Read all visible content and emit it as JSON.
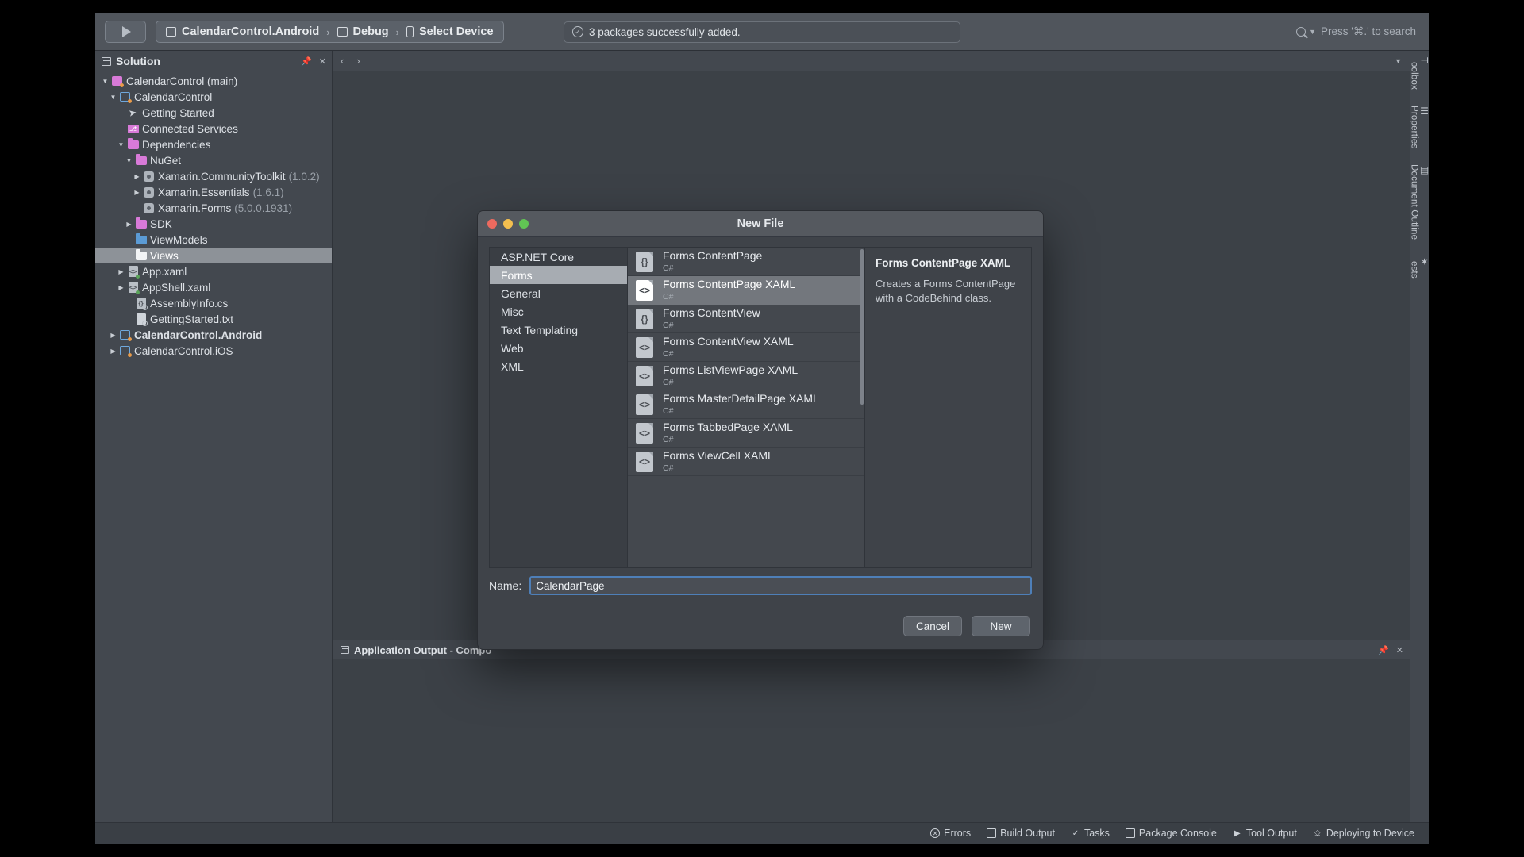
{
  "toolbar": {
    "run_button_icon": "play-triangle-icon",
    "target_project": "CalendarControl.Android",
    "configuration": "Debug",
    "device": "Select Device",
    "separator": "›",
    "status_message": "3 packages successfully added.",
    "status_icon": "check-circle-icon",
    "search_placeholder": "Press '⌘.' to search"
  },
  "solution_pad": {
    "title": "Solution",
    "pin_icon": "pin-icon",
    "close_icon": "close-icon",
    "tree": [
      {
        "label": "CalendarControl (main)",
        "indent": 0,
        "twisty": "▼",
        "icon": "solution-icon",
        "bold": false
      },
      {
        "label": "CalendarControl",
        "indent": 1,
        "twisty": "▼",
        "icon": "project-icon",
        "bold": false
      },
      {
        "label": "Getting Started",
        "indent": 2,
        "twisty": "",
        "icon": "rocket-icon",
        "bold": false
      },
      {
        "label": "Connected Services",
        "indent": 2,
        "twisty": "",
        "icon": "connected-services-icon",
        "bold": false
      },
      {
        "label": "Dependencies",
        "indent": 2,
        "twisty": "▼",
        "icon": "dependencies-folder-icon",
        "bold": false
      },
      {
        "label": "NuGet",
        "indent": 3,
        "twisty": "▼",
        "icon": "nuget-folder-icon",
        "bold": false
      },
      {
        "label": "Xamarin.CommunityToolkit",
        "version": "(1.0.2)",
        "indent": 4,
        "twisty": "▶",
        "icon": "package-icon",
        "bold": false
      },
      {
        "label": "Xamarin.Essentials",
        "version": "(1.6.1)",
        "indent": 4,
        "twisty": "▶",
        "icon": "package-icon",
        "bold": false
      },
      {
        "label": "Xamarin.Forms",
        "version": "(5.0.0.1931)",
        "indent": 4,
        "twisty": "",
        "icon": "package-icon",
        "bold": false
      },
      {
        "label": "SDK",
        "indent": 3,
        "twisty": "▶",
        "icon": "sdk-folder-icon",
        "bold": false
      },
      {
        "label": "ViewModels",
        "indent": 3,
        "twisty": "",
        "icon": "folder-blue-icon",
        "bold": false
      },
      {
        "label": "Views",
        "indent": 3,
        "twisty": "",
        "icon": "folder-white-icon",
        "bold": false,
        "selected": true
      },
      {
        "label": "App.xaml",
        "indent": 2,
        "twisty": "▶",
        "icon": "xaml-file-icon",
        "bold": false
      },
      {
        "label": "AppShell.xaml",
        "indent": 2,
        "twisty": "▶",
        "icon": "xaml-file-icon",
        "bold": false
      },
      {
        "label": "AssemblyInfo.cs",
        "indent": 3,
        "twisty": "",
        "icon": "csharp-file-icon",
        "bold": false
      },
      {
        "label": "GettingStarted.txt",
        "indent": 3,
        "twisty": "",
        "icon": "text-file-icon",
        "bold": false
      },
      {
        "label": "CalendarControl.Android",
        "indent": 1,
        "twisty": "▶",
        "icon": "project-icon",
        "bold": true
      },
      {
        "label": "CalendarControl.iOS",
        "indent": 1,
        "twisty": "▶",
        "icon": "project-icon",
        "bold": false
      }
    ]
  },
  "editor": {
    "back_icon": "chevron-left-icon",
    "forward_icon": "chevron-right-icon",
    "overflow_icon": "chevron-down-icon"
  },
  "app_output": {
    "title": "Application Output - Compo",
    "pin_icon": "pin-icon",
    "close_icon": "close-icon"
  },
  "right_rail": [
    {
      "label": "Toolbox",
      "glyph": "T"
    },
    {
      "label": "Properties",
      "glyph": "☰"
    },
    {
      "label": "Document Outline",
      "glyph": "▤"
    },
    {
      "label": "Tests",
      "glyph": "✦"
    }
  ],
  "status_bar": [
    {
      "label": "Errors",
      "icon": "error-circle-icon"
    },
    {
      "label": "Build Output",
      "icon": "build-output-icon"
    },
    {
      "label": "Tasks",
      "icon": "check-icon"
    },
    {
      "label": "Package Console",
      "icon": "console-icon"
    },
    {
      "label": "Tool Output",
      "icon": "play-icon"
    },
    {
      "label": "Deploying to Device",
      "icon": "deploy-icon"
    }
  ],
  "dialog": {
    "title": "New File",
    "traffic_lights": {
      "close": "close-button",
      "minimize": "minimize-button",
      "zoom": "zoom-button"
    },
    "categories": [
      {
        "label": "ASP.NET Core",
        "selected": false
      },
      {
        "label": "Forms",
        "selected": true
      },
      {
        "label": "General",
        "selected": false
      },
      {
        "label": "Misc",
        "selected": false
      },
      {
        "label": "Text Templating",
        "selected": false
      },
      {
        "label": "Web",
        "selected": false
      },
      {
        "label": "XML",
        "selected": false
      }
    ],
    "templates": [
      {
        "name": "Forms ContentPage",
        "lang": "C#",
        "icon": "braces-file-icon",
        "selected": false
      },
      {
        "name": "Forms ContentPage XAML",
        "lang": "C#",
        "icon": "xaml-file-icon",
        "selected": true
      },
      {
        "name": "Forms ContentView",
        "lang": "C#",
        "icon": "braces-file-icon",
        "selected": false
      },
      {
        "name": "Forms ContentView XAML",
        "lang": "C#",
        "icon": "xaml-file-icon",
        "selected": false
      },
      {
        "name": "Forms ListViewPage XAML",
        "lang": "C#",
        "icon": "xaml-file-icon",
        "selected": false
      },
      {
        "name": "Forms MasterDetailPage XAML",
        "lang": "C#",
        "icon": "xaml-file-icon",
        "selected": false
      },
      {
        "name": "Forms TabbedPage XAML",
        "lang": "C#",
        "icon": "xaml-file-icon",
        "selected": false
      },
      {
        "name": "Forms ViewCell XAML",
        "lang": "C#",
        "icon": "xaml-file-icon",
        "selected": false
      }
    ],
    "description": {
      "title": "Forms ContentPage XAML",
      "body": "Creates a Forms ContentPage with a CodeBehind class."
    },
    "name_field": {
      "label": "Name:",
      "value": "CalendarPage",
      "placeholder": ""
    },
    "cancel_label": "Cancel",
    "new_label": "New"
  },
  "colors": {
    "accent_blue": "#4e7fb8",
    "selection_gray": "#8d9298",
    "window_bg": "#3a3f45",
    "pad_bg": "#43484f"
  }
}
